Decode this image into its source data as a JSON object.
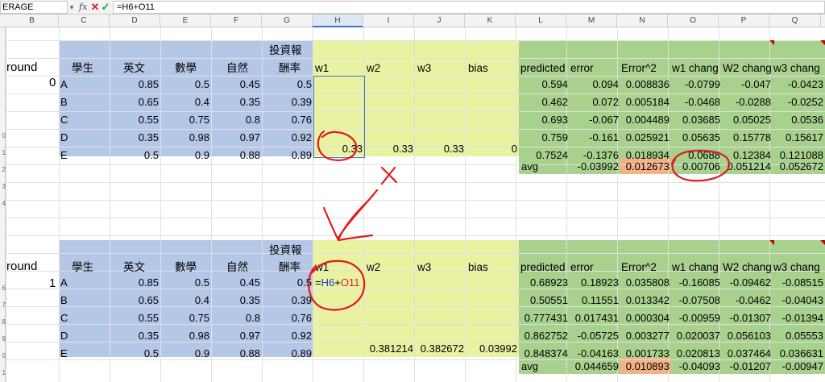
{
  "formula_bar": {
    "name_box": "ERAGE",
    "fx": "fx",
    "cancel": "✕",
    "accept": "✓",
    "formula": "=H6+O11"
  },
  "columns": [
    "B",
    "C",
    "D",
    "E",
    "F",
    "G",
    "H",
    "I",
    "J",
    "K",
    "L",
    "M",
    "N",
    "O",
    "P",
    "Q"
  ],
  "selected_column": "H",
  "row_numbers": [
    "",
    "",
    "",
    "",
    "",
    "",
    "0",
    "1",
    "2",
    "3",
    "4",
    "",
    "",
    "",
    "",
    "6",
    "7",
    "8",
    "9",
    "0",
    "1",
    ""
  ],
  "top": {
    "round_label": "round",
    "round_value": "0",
    "headers": {
      "student": "學生",
      "english": "英文",
      "math": "數學",
      "science": "自然",
      "roi_line1": "投資報",
      "roi_line2": "酬率",
      "w1": "w1",
      "w2": "w2",
      "w3": "w3",
      "bias": "bias",
      "predicted": "predicted",
      "error": "error",
      "error_sq": "Error^2",
      "w1_change": "w1 chang",
      "w2_change": "W2 chang",
      "w3_change": "w3 chang"
    },
    "rows": [
      {
        "student": "A",
        "english": "0.85",
        "math": "0.5",
        "science": "0.45",
        "roi": "0.5",
        "predicted": "0.594",
        "error": "0.094",
        "error_sq": "0.008836",
        "w1c": "-0.0799",
        "w2c": "-0.047",
        "w3c": "-0.0423"
      },
      {
        "student": "B",
        "english": "0.65",
        "math": "0.4",
        "science": "0.35",
        "roi": "0.39",
        "predicted": "0.462",
        "error": "0.072",
        "error_sq": "0.005184",
        "w1c": "-0.0468",
        "w2c": "-0.0288",
        "w3c": "-0.0252"
      },
      {
        "student": "C",
        "english": "0.55",
        "math": "0.75",
        "science": "0.8",
        "roi": "0.76",
        "predicted": "0.693",
        "error": "-0.067",
        "error_sq": "0.004489",
        "w1c": "0.03685",
        "w2c": "0.05025",
        "w3c": "0.0536"
      },
      {
        "student": "D",
        "english": "0.35",
        "math": "0.98",
        "science": "0.97",
        "roi": "0.92",
        "predicted": "0.759",
        "error": "-0.161",
        "error_sq": "0.025921",
        "w1c": "0.05635",
        "w2c": "0.15778",
        "w3c": "0.15617"
      },
      {
        "student": "E",
        "english": "0.5",
        "math": "0.9",
        "science": "0.88",
        "roi": "0.89",
        "predicted": "0.7524",
        "error": "-0.1376",
        "error_sq": "0.018934",
        "w1c": "0.0688",
        "w2c": "0.12384",
        "w3c": "0.121088"
      }
    ],
    "weights": {
      "w1": "0.33",
      "w2": "0.33",
      "w3": "0.33",
      "bias": "0"
    },
    "avg": {
      "label": "avg",
      "error": "-0.03992",
      "error_sq": "0.012673",
      "w1c": "0.00706",
      "w2c": "0.051214",
      "w3c": "0.052672"
    }
  },
  "bottom": {
    "round_label": "round",
    "round_value": "1",
    "headers": {
      "student": "學生",
      "english": "英文",
      "math": "數學",
      "science": "自然",
      "roi_line1": "投資報",
      "roi_line2": "酬率",
      "w1": "w1",
      "w2": "w2",
      "w3": "w3",
      "bias": "bias",
      "predicted": "predicted",
      "error": "error",
      "error_sq": "Error^2",
      "w1_change": "w1 chang",
      "w2_change": "W2 chang",
      "w3_change": "w3 chang"
    },
    "rows": [
      {
        "student": "A",
        "english": "0.85",
        "math": "0.5",
        "science": "0.45",
        "roi": "0.5",
        "predicted": "0.68923",
        "error": "0.18923",
        "error_sq": "0.035808",
        "w1c": "-0.16085",
        "w2c": "-0.09462",
        "w3c": "-0.08515"
      },
      {
        "student": "B",
        "english": "0.65",
        "math": "0.4",
        "science": "0.35",
        "roi": "0.39",
        "predicted": "0.50551",
        "error": "0.11551",
        "error_sq": "0.013342",
        "w1c": "-0.07508",
        "w2c": "-0.0462",
        "w3c": "-0.04043"
      },
      {
        "student": "C",
        "english": "0.55",
        "math": "0.75",
        "science": "0.8",
        "roi": "0.76",
        "predicted": "0.777431",
        "error": "0.017431",
        "error_sq": "0.000304",
        "w1c": "-0.00959",
        "w2c": "-0.01307",
        "w3c": "-0.01394"
      },
      {
        "student": "D",
        "english": "0.35",
        "math": "0.98",
        "science": "0.97",
        "roi": "0.92",
        "predicted": "0.862752",
        "error": "-0.05725",
        "error_sq": "0.003277",
        "w1c": "0.020037",
        "w2c": "0.056103",
        "w3c": "0.05553"
      },
      {
        "student": "E",
        "english": "0.5",
        "math": "0.9",
        "science": "0.88",
        "roi": "0.89",
        "predicted": "0.848374",
        "error": "-0.04163",
        "error_sq": "0.001733",
        "w1c": "0.020813",
        "w2c": "0.037464",
        "w3c": "0.036631"
      }
    ],
    "formula_tokens": {
      "eq": "=",
      "ref1": "H6",
      "plus": "+",
      "ref2": "O11"
    },
    "weights": {
      "w2": "0.381214",
      "w3": "0.382672",
      "bias": "0.03992"
    },
    "avg": {
      "label": "avg",
      "error": "0.044659",
      "error_sq": "0.010893",
      "w1c": "-0.04093",
      "w2c": "-0.01207",
      "w3c": "-0.00947"
    }
  },
  "colors": {
    "blue": "#b4c7e7",
    "yellow": "#e9f2a1",
    "green": "#a9d18e",
    "orange": "#f4b183",
    "annotation": "#e01b1b"
  }
}
